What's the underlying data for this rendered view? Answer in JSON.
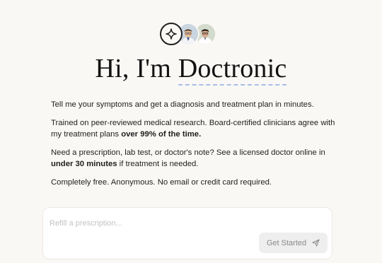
{
  "header": {
    "logo_icon": "sparkle-icon",
    "avatars": [
      "doctor-avatar-1",
      "doctor-avatar-2"
    ],
    "title_prefix": "Hi, I'm ",
    "title_name": "Doctronic"
  },
  "intro": {
    "p1": "Tell me your symptoms and get a diagnosis and treatment plan in minutes.",
    "p2_text": "Trained on peer-reviewed medical research. Board-certified clinicians agree with my treatment plans ",
    "p2_bold": "over 99% of the time.",
    "p3_text": "Need a prescription, lab test, or doctor's note? See a licensed doctor online in ",
    "p3_bold": "under 30 minutes",
    "p3_after": " if treatment is needed.",
    "p4": "Completely free. Anonymous. No email or credit card required."
  },
  "prompt": {
    "placeholder": "Refill a prescription...",
    "submit_label": "Get Started",
    "submit_icon": "send-icon"
  },
  "colors": {
    "background": "#faf8f5",
    "title_underline": "#a9bde8",
    "button_bg": "#eeeeee",
    "button_text": "#8a8a8a"
  }
}
